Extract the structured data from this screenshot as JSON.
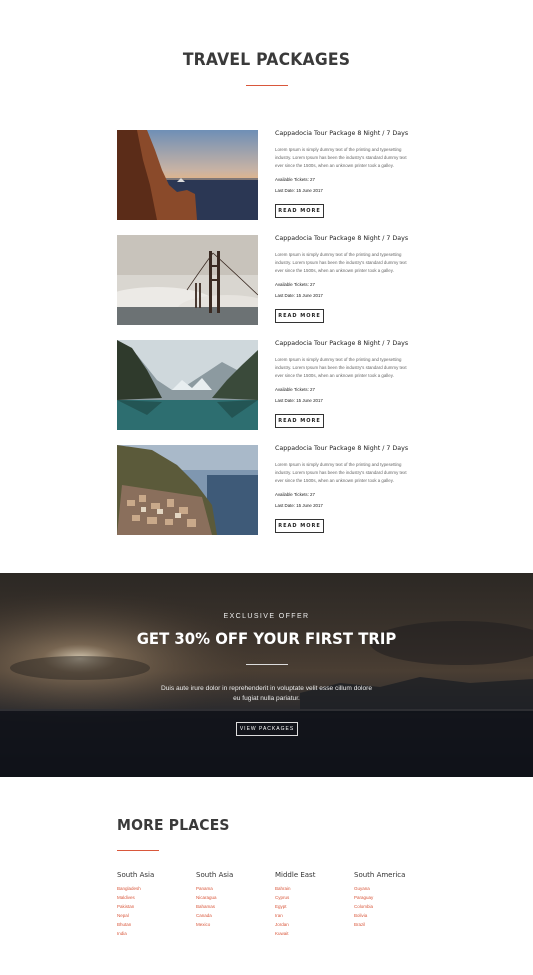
{
  "packages": {
    "title": "TRAVEL PACKAGES",
    "items": [
      {
        "title": "Cappadocia Tour Package 8 Night / 7 Days",
        "description": "Lorem Ipsum is simply dummy text of the printing and typesetting industry. Lorem Ipsum has been the industry's standard dummy text ever since the 1500s, when an unknown printer took a galley.",
        "tickets": "Available Tickets: 27",
        "date": "Last Date: 15 June 2017",
        "button": "READ MORE",
        "image": "cliff-coast"
      },
      {
        "title": "Cappadocia Tour Package 8 Night / 7 Days",
        "description": "Lorem Ipsum is simply dummy text of the printing and typesetting industry. Lorem Ipsum has been the industry's standard dummy text ever since the 1500s, when an unknown printer took a galley.",
        "tickets": "Available Tickets: 27",
        "date": "Last Date: 15 June 2017",
        "button": "READ MORE",
        "image": "bridge-fog"
      },
      {
        "title": "Cappadocia Tour Package 8 Night / 7 Days",
        "description": "Lorem Ipsum is simply dummy text of the printing and typesetting industry. Lorem Ipsum has been the industry's standard dummy text ever since the 1500s, when an unknown printer took a galley.",
        "tickets": "Available Tickets: 27",
        "date": "Last Date: 15 June 2017",
        "button": "READ MORE",
        "image": "mountain-lake"
      },
      {
        "title": "Cappadocia Tour Package 8 Night / 7 Days",
        "description": "Lorem Ipsum is simply dummy text of the printing and typesetting industry. Lorem Ipsum has been the industry's standard dummy text ever since the 1500s, when an unknown printer took a galley.",
        "tickets": "Available Tickets: 27",
        "date": "Last Date: 15 June 2017",
        "button": "READ MORE",
        "image": "cliff-village"
      }
    ]
  },
  "offer": {
    "eyebrow": "EXCLUSIVE OFFER",
    "title": "GET 30% OFF YOUR FIRST TRIP",
    "text": "Duis aute irure dolor in reprehenderit in voluptate velit esse cillum dolore eu fugiat nulla pariatur.",
    "button": "VIEW PACKAGES"
  },
  "places": {
    "title": "MORE PLACES",
    "columns": [
      {
        "heading": "South Asia",
        "items": [
          "Bangladesh",
          "Maldives",
          "Pakistan",
          "Nepal",
          "Bhutan",
          "India"
        ]
      },
      {
        "heading": "South Asia",
        "items": [
          "Panama",
          "Nicaragua",
          "Bahamas",
          "Canada",
          "Mexico"
        ]
      },
      {
        "heading": "Middle East",
        "items": [
          "Bahrain",
          "Cyprus",
          "Egypt",
          "Iran",
          "Jordan",
          "Kuwait"
        ]
      },
      {
        "heading": "South America",
        "items": [
          "Guyana",
          "Paraguay",
          "Colombia",
          "Bolivia",
          "Brazil"
        ]
      }
    ]
  },
  "colors": {
    "accent": "#d9573b",
    "text": "#3a3a3a"
  }
}
